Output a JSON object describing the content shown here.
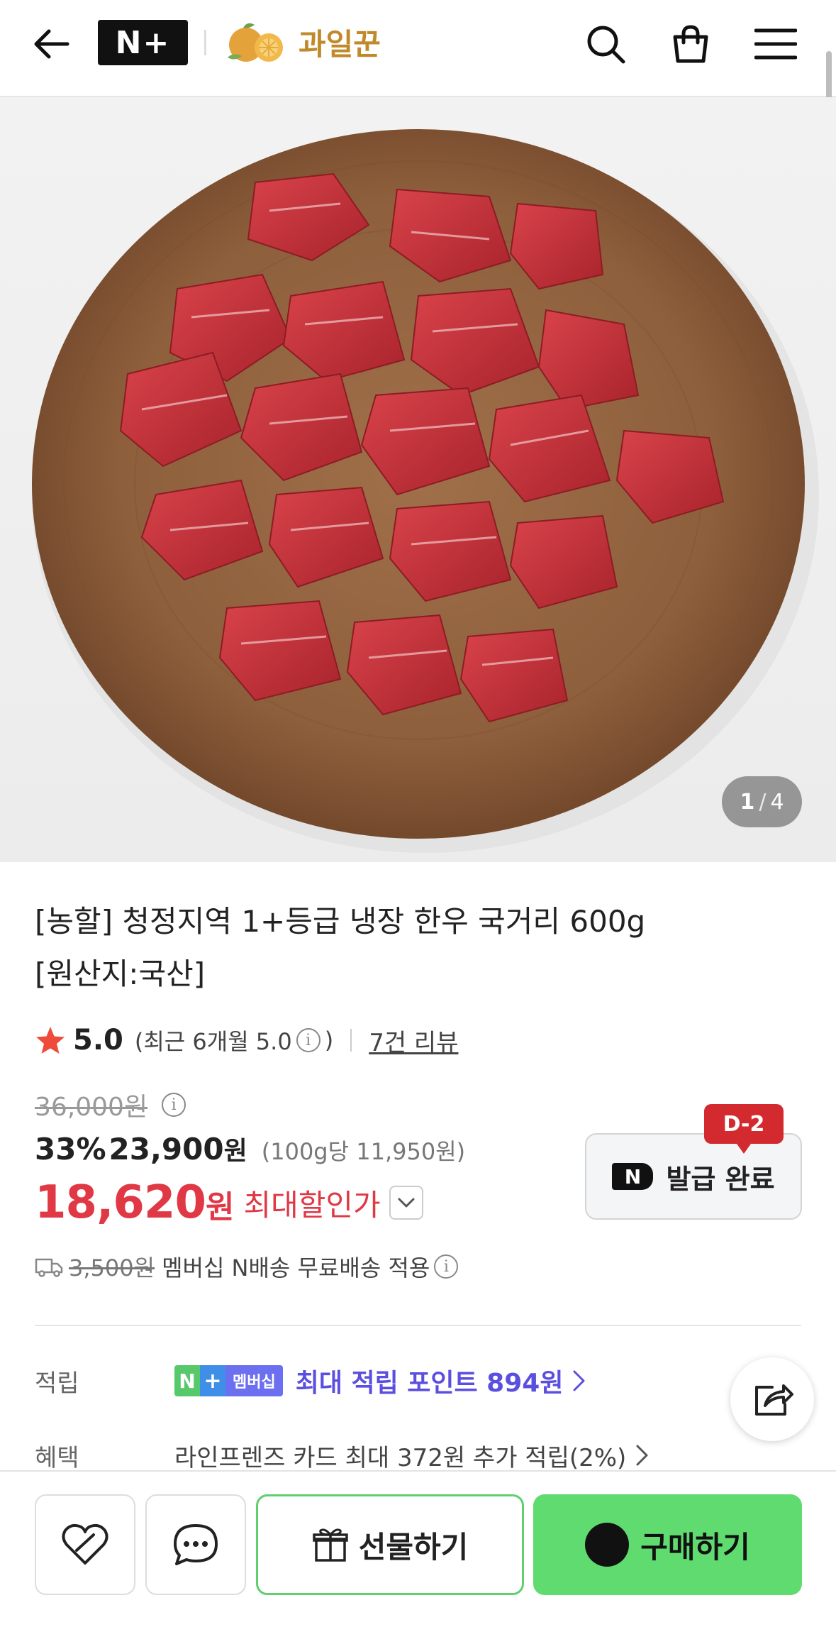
{
  "header": {
    "back_icon": "arrow-left-icon",
    "nplus_label": "N+",
    "store_name": "과일꾼",
    "icons": [
      "search-icon",
      "shopping-bag-icon",
      "menu-icon"
    ]
  },
  "gallery": {
    "current": "1",
    "separator": "/",
    "total": "4"
  },
  "product": {
    "title_line1": "[농할] 청정지역 1+등급 냉장 한우 국거리 600g",
    "title_line2": "[원산지:국산]",
    "rating": "5.0",
    "rating_recent_prefix": "(최근 6개월 5.0",
    "rating_recent_suffix": ")",
    "review_link": "7건 리뷰",
    "original_price": "36,000원",
    "discount": "33%",
    "sale_price_number": "23,900",
    "sale_price_unit": "원",
    "unit_price": "(100g당 11,950원)",
    "max_price_number": "18,620",
    "max_price_unit": "원",
    "max_price_label": "최대할인가",
    "coupon_badge": "D-2",
    "coupon_n": "N",
    "coupon_label": "발급 완료",
    "shipping_original": "3,500원",
    "shipping_text": "멤버십 N배송 무료배송 적용"
  },
  "points": {
    "label": "적립",
    "badge_n": "N",
    "badge_plus": "+",
    "badge_text": "멤버십",
    "text": "최대 적립 포인트 894원"
  },
  "benefits": {
    "label": "혜택",
    "text": "라인프렌즈 카드 최대 372원 추가 적립(2%)"
  },
  "bottom_bar": {
    "gift_label": "선물하기",
    "buy_n": "N",
    "buy_label": "구매하기"
  },
  "colors": {
    "accent_red": "#e03845",
    "accent_green": "#5fdb70",
    "accent_purple": "#5b4fe0",
    "dday_red": "#d32a2f"
  }
}
